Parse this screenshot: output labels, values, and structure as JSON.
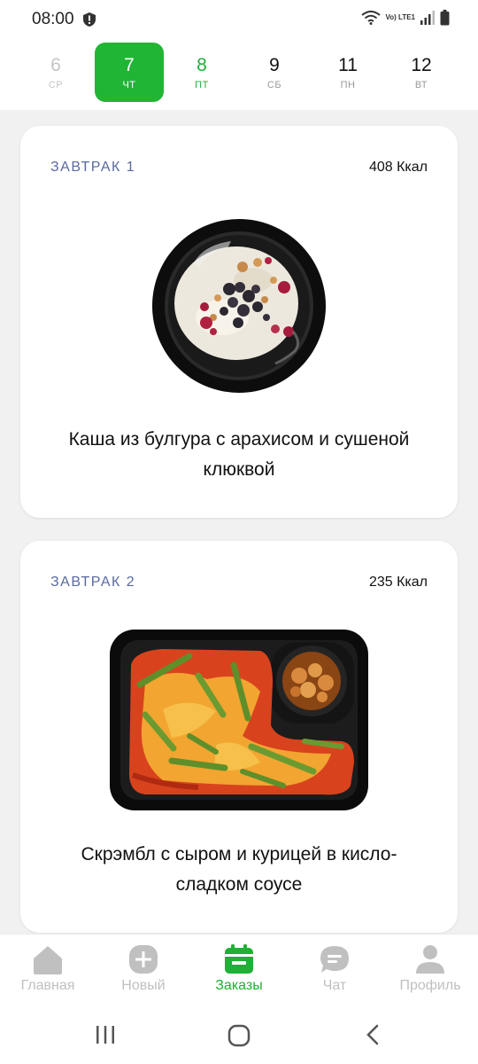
{
  "status": {
    "time": "08:00",
    "network": "Vo) LTE1"
  },
  "days": [
    {
      "num": "6",
      "dow": "ср",
      "state": "past"
    },
    {
      "num": "7",
      "dow": "чт",
      "state": "active"
    },
    {
      "num": "8",
      "dow": "пт",
      "state": "next"
    },
    {
      "num": "9",
      "dow": "сб",
      "state": "future"
    },
    {
      "num": "11",
      "dow": "пн",
      "state": "future"
    },
    {
      "num": "12",
      "dow": "вт",
      "state": "future"
    }
  ],
  "meals": [
    {
      "name": "ЗАВТРАК 1",
      "kcal": "408 Ккал",
      "title": "Каша из булгура с арахисом и сушеной клюквой",
      "image": "bulgur-porridge-bowl"
    },
    {
      "name": "ЗАВТРАК 2",
      "kcal": "235 Ккал",
      "title": "Скрэмбл с сыром и курицей в кисло-сладком соусе",
      "image": "scramble-container"
    }
  ],
  "tabs": [
    {
      "label": "Главная",
      "icon": "home-icon"
    },
    {
      "label": "Новый",
      "icon": "plus-circle-icon"
    },
    {
      "label": "Заказы",
      "icon": "calendar-icon",
      "active": true
    },
    {
      "label": "Чат",
      "icon": "chat-icon"
    },
    {
      "label": "Профиль",
      "icon": "person-icon"
    }
  ],
  "colors": {
    "accent": "#20b534",
    "meal_label": "#5b6aa0",
    "inactive": "#c0c0c0"
  }
}
